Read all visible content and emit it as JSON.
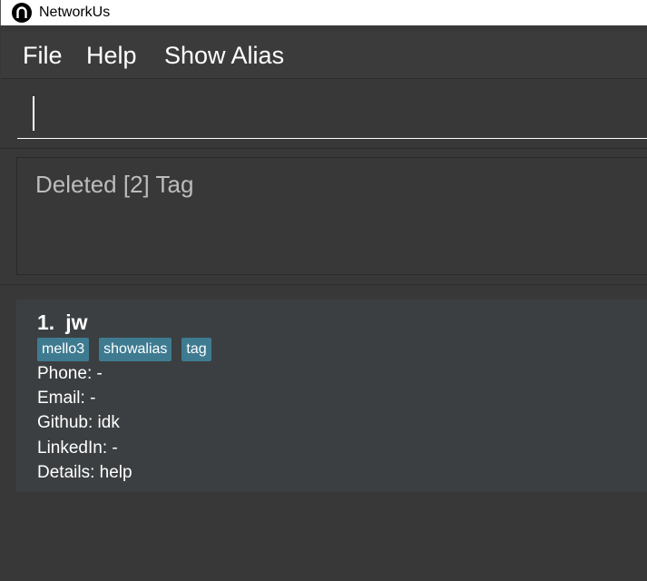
{
  "window": {
    "title": "NetworkUs"
  },
  "menu": {
    "items": [
      "File",
      "Help",
      "Show Alias"
    ]
  },
  "command": {
    "value": ""
  },
  "result": {
    "text": "Deleted [2] Tag"
  },
  "persons": [
    {
      "index": "1.",
      "name": "jw",
      "tags": [
        "mello3",
        "showalias",
        "tag"
      ],
      "phone": "Phone: -",
      "email": "Email: -",
      "github": "Github: idk",
      "linkedin": "LinkedIn: -",
      "details": "Details: help"
    }
  ],
  "colors": {
    "background": "#383838",
    "card": "#3c3f41",
    "tag": "#3e7b91",
    "result_text": "#bcbcbc"
  }
}
